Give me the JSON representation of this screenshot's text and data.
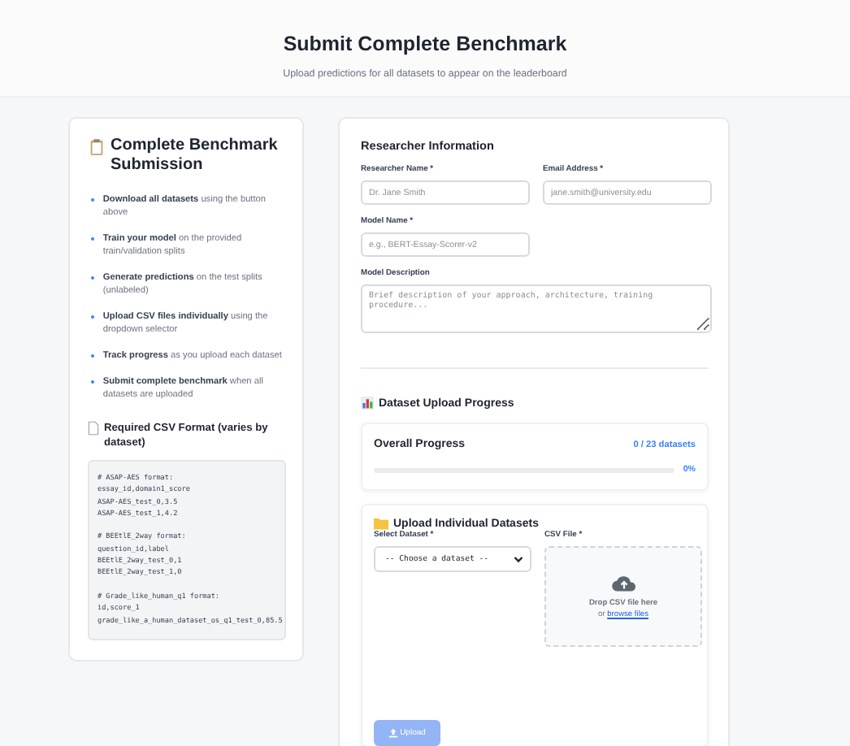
{
  "header": {
    "title": "Submit Complete Benchmark",
    "subtitle": "Upload predictions for all datasets to appear on the leaderboard"
  },
  "instructions": {
    "title": "Complete Benchmark Submission",
    "steps": [
      "**Download all datasets** using the button above",
      "**Train your model** on the provided train/validation splits",
      "**Generate predictions** on the test splits (unlabeled)",
      "**Upload CSV files individually** using the dropdown selector",
      "**Track progress** as you upload each dataset",
      "**Submit complete benchmark** when all datasets are uploaded"
    ],
    "format_title": "Required CSV Format (varies by dataset)",
    "code": [
      [
        "# ASAP-AES format:",
        "essay_id,domain1_score",
        "ASAP-AES_test_0,3.5",
        "ASAP-AES_test_1,4.2"
      ],
      [
        "# BEEtlE_2way format:",
        "question_id,label",
        "BEEtlE_2way_test_0,1",
        "BEEtlE_2way_test_1,0"
      ],
      [
        "# Grade_like_human_q1 format:",
        "id,score_1",
        "grade_like_a_human_dataset_os_q1_test_0,85.5"
      ]
    ]
  },
  "researcher": {
    "title": "Researcher Information",
    "fields": [
      {
        "label": "Researcher Name *",
        "placeholder": "Dr. Jane Smith",
        "kind": "input"
      },
      {
        "label": "Email Address *",
        "placeholder": "jane.smith@university.edu",
        "kind": "input"
      },
      {
        "label": "Model Name *",
        "placeholder": "e.g., BERT-Essay-Scorer-v2",
        "kind": "input"
      },
      {
        "label": "Model Description",
        "placeholder": "Brief description of your approach, architecture, training procedure...",
        "kind": "textarea"
      }
    ]
  },
  "progress": {
    "title": "Dataset Upload Progress",
    "label": "Overall Progress",
    "count": "0 / 23 datasets",
    "level": 0,
    "percent": "0%"
  },
  "upload": {
    "title": "Upload Individual Datasets",
    "select_label": "Select Dataset *",
    "select_value": "-- Choose a dataset --",
    "file_label": "CSV File *",
    "drop_text": "Drop CSV file here",
    "or_text": "or",
    "browse_link": "browse files",
    "button": {
      "label": "Upload",
      "disabled": true
    }
  }
}
